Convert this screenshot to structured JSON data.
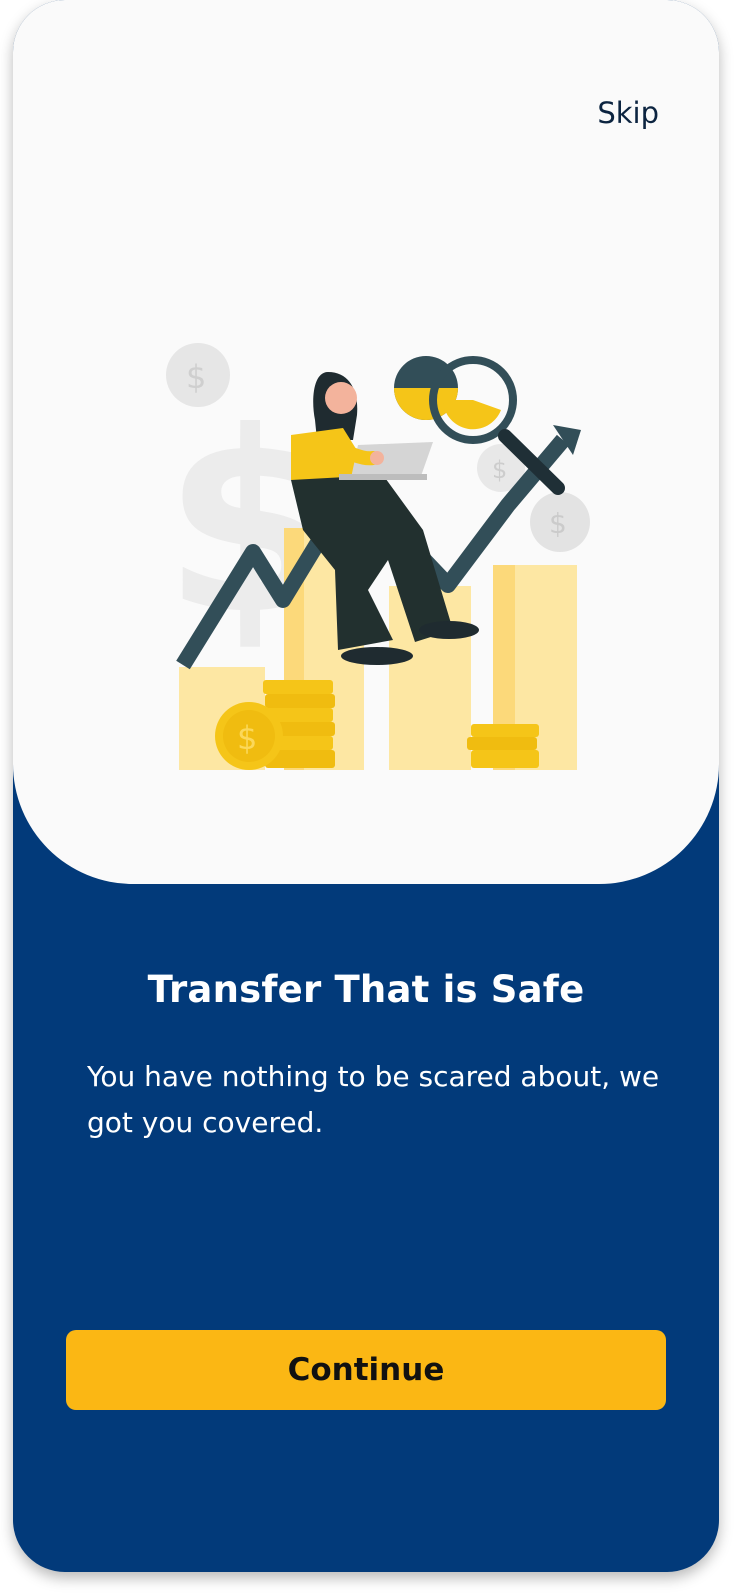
{
  "header": {
    "skip_label": "Skip"
  },
  "onboarding": {
    "title": "Transfer That is Safe",
    "description": "You have nothing to be scared about, we got you covered.",
    "illustration_icon": "woman-laptop-finance-illustration"
  },
  "actions": {
    "continue_label": "Continue"
  },
  "colors": {
    "background_top": "#fafafa",
    "background_bottom": "#023a7a",
    "accent": "#fbb714",
    "text_dark": "#0c2440"
  }
}
